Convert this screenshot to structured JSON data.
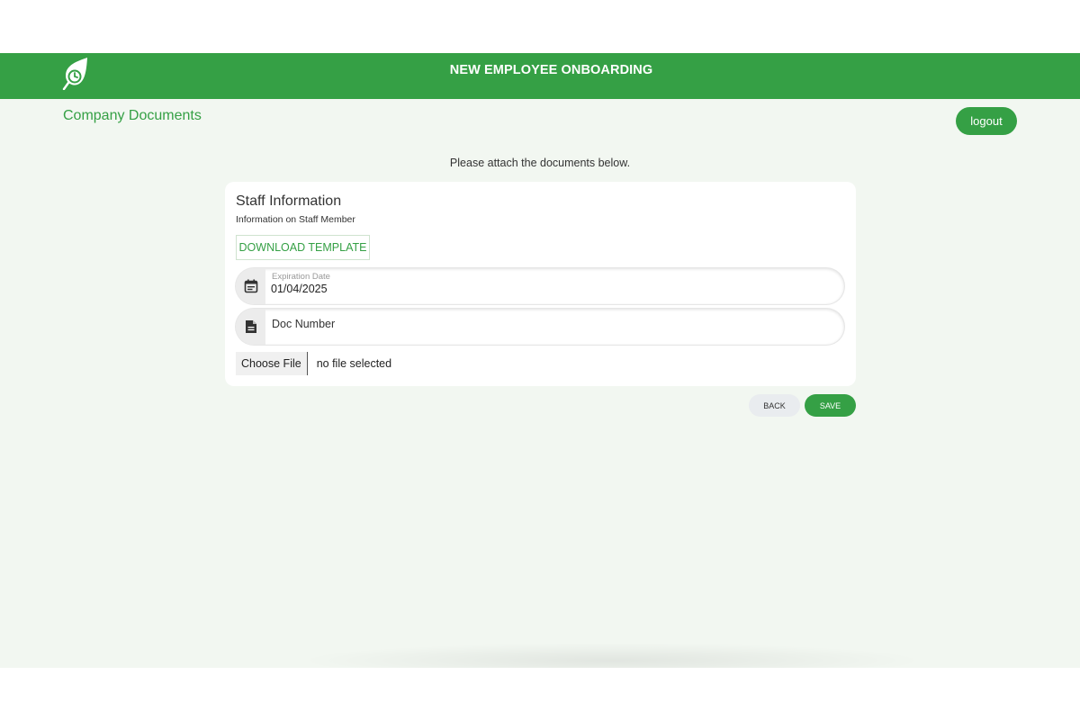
{
  "header": {
    "title": "NEW EMPLOYEE ONBOARDING",
    "logo_icon": "leaf-clock-logo",
    "brand_color": "#35a045"
  },
  "page": {
    "section_title": "Company Documents",
    "logout_label": "logout",
    "instruction": "Please attach the documents below."
  },
  "card": {
    "title": "Staff Information",
    "subtitle": "Information on Staff Member",
    "download_label": "DOWNLOAD TEMPLATE",
    "expiration_field": {
      "label": "Expiration Date",
      "value": "01/04/2025",
      "icon": "calendar-icon"
    },
    "doc_number_field": {
      "placeholder": "Doc Number",
      "icon": "document-icon"
    },
    "file_input": {
      "button_label": "Choose File",
      "status": "no file selected"
    }
  },
  "actions": {
    "back_label": "BACK",
    "save_label": "SAVE"
  }
}
